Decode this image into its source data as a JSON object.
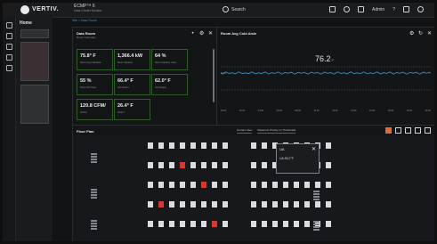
{
  "topbar": {
    "brand": "VERTIV.",
    "product": "ECMP™ 6",
    "product_sub": "Data Center Monitor",
    "search_placeholder": "Search",
    "user": "Admin",
    "help": "?"
  },
  "nav": {
    "home": "Home"
  },
  "breadcrumb": "Site  >  Data Room",
  "summary": {
    "title": "Data Room",
    "subtitle": "Room Summary",
    "tiles": [
      {
        "value": "75.8° F",
        "label": "Room Avg Cold Aisle"
      },
      {
        "value": "1,366.4 kW",
        "label": "Room Capacity"
      },
      {
        "value": "64 %",
        "label": "Room Capacity Used"
      },
      {
        "value": "55 %",
        "label": "Room CW Used"
      },
      {
        "value": "66.4° F",
        "label": "Unit Return"
      },
      {
        "value": "62.0° F",
        "label": "Unit Supply"
      },
      {
        "value": "120.8 CFM/",
        "label": "Airflow"
      },
      {
        "value": "26.4° F",
        "label": "Delta T"
      }
    ]
  },
  "trend": {
    "title": "Room Avg Cold Aisle",
    "value": "76.2",
    "unit": "°F",
    "label_left": "Band",
    "x_ticks": [
      "00:00",
      "02:00",
      "04:00",
      "06:00",
      "08:00",
      "10:00",
      "12:00",
      "14:00",
      "16:00",
      "18:00",
      "20:00",
      "22:00"
    ]
  },
  "floor": {
    "title": "Floor Plan",
    "mode": "Current View",
    "filter": "Maximum Priority on Thresholds",
    "popup_title": "UA",
    "popup_value": "UA    85.2°F"
  },
  "colors": {
    "accent": "#3a8fd6",
    "tile_border": "#2f5a2a",
    "alert": "#d43a2f",
    "trend_line": "#3a9ad8"
  }
}
